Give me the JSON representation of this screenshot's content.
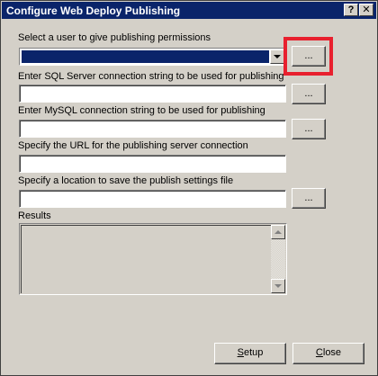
{
  "window": {
    "title": "Configure Web Deploy Publishing",
    "help_label": "?",
    "close_label": "✕"
  },
  "user": {
    "label": "Select a user to give publishing permissions",
    "selected_value": "",
    "browse_label": "..."
  },
  "sql": {
    "label": "Enter SQL Server connection string to be used for publishing",
    "value": "",
    "browse_label": "..."
  },
  "mysql": {
    "label": "Enter MySQL connection string to be used for publishing",
    "value": "",
    "browse_label": "..."
  },
  "url": {
    "label": "Specify the URL for the publishing server connection",
    "value": ""
  },
  "location": {
    "label": "Specify a location to save the publish settings file",
    "value": "",
    "browse_label": "..."
  },
  "results": {
    "label": "Results"
  },
  "footer": {
    "setup_mnemonic": "S",
    "setup_rest": "etup",
    "close_mnemonic": "C",
    "close_rest": "lose"
  },
  "colors": {
    "highlight": "#e8202e",
    "titlebar": "#0a246a",
    "window_bg": "#d4d0c8"
  }
}
